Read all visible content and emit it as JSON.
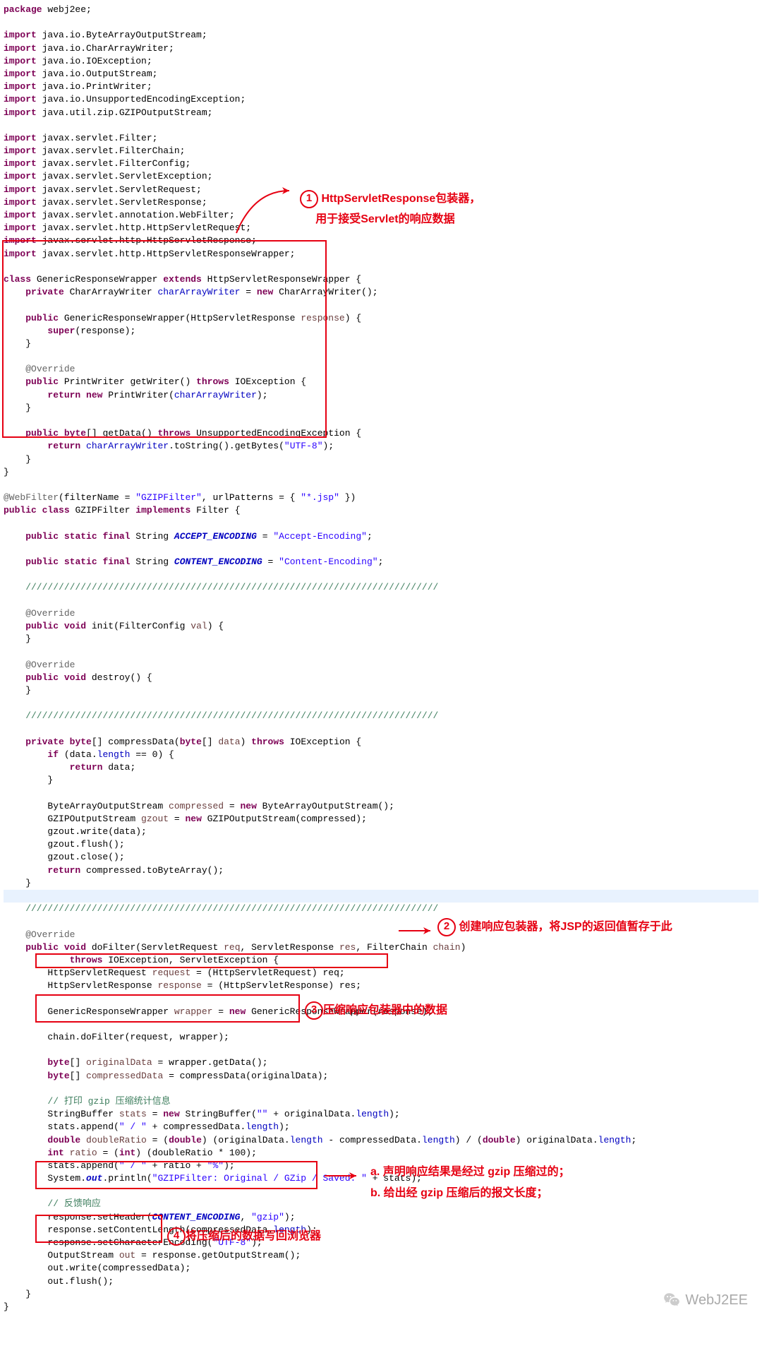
{
  "code": {
    "pkg_kw": "package",
    "pkg_name": " webj2ee;",
    "imp_kw": "import",
    "imp1": " java.io.ByteArrayOutputStream;",
    "imp2": " java.io.CharArrayWriter;",
    "imp3": " java.io.IOException;",
    "imp4": " java.io.OutputStream;",
    "imp5": " java.io.PrintWriter;",
    "imp6": " java.io.UnsupportedEncodingException;",
    "imp7": " java.util.zip.GZIPOutputStream;",
    "imp8": " javax.servlet.Filter;",
    "imp9": " javax.servlet.FilterChain;",
    "imp10": " javax.servlet.FilterConfig;",
    "imp11": " javax.servlet.ServletException;",
    "imp12": " javax.servlet.ServletRequest;",
    "imp13": " javax.servlet.ServletResponse;",
    "imp14": " javax.servlet.annotation.WebFilter;",
    "imp15": " javax.servlet.http.HttpServletRequest;",
    "imp16": " javax.servlet.http.HttpServletResponse;",
    "imp17": " javax.servlet.http.HttpServletResponseWrapper;",
    "class_kw": "class",
    "extends_kw": "extends",
    "private_kw": "private",
    "new_kw": "new",
    "public_kw": "public",
    "super_kw": "super",
    "return_kw": "return",
    "throws_kw": "throws",
    "byte_kw": "byte",
    "static_kw": "static",
    "final_kw": "final",
    "implements_kw": "implements",
    "void_kw": "void",
    "if_kw": "if",
    "int_kw": "int",
    "double_kw": "double",
    "grw_name": " GenericResponseWrapper ",
    "grw_ext": " HttpServletResponseWrapper {",
    "grw_fld1": " CharArrayWriter ",
    "grw_fldname": "charArrayWriter",
    "grw_fldinit": " CharArrayWriter();",
    "grw_ctor": " GenericResponseWrapper(HttpServletResponse ",
    "grw_ctor_p": "response",
    "grw_ctor_end": ") {",
    "grw_super": "(response);",
    "override": "@Override",
    "grw_gw1": " PrintWriter getWriter() ",
    "grw_gw2": " IOException {",
    "grw_gw_ret": " PrintWriter(",
    "grw_gw_ret2": ");",
    "grw_gd1": "[] getData() ",
    "grw_gd2": " UnsupportedEncodingException {",
    "grw_gd_ret1": ".toString().getBytes(",
    "grw_utf8": "\"UTF-8\"",
    "grw_gd_ret2": ");",
    "wf_ann": "@WebFilter",
    "wf_params": "(filterName = ",
    "wf_fn": "\"GZIPFilter\"",
    "wf_mid": ", urlPatterns = { ",
    "wf_pat": "\"*.jsp\"",
    "wf_end": " })",
    "gzf_decl": " GZIPFilter ",
    "gzf_impl": " Filter {",
    "ae_decl": " String ",
    "ae_name": "ACCEPT_ENCODING",
    "ae_eq": " = ",
    "ae_val": "\"Accept-Encoding\"",
    "semi": ";",
    "ce_name": "CONTENT_ENCODING",
    "ce_val": "\"Content-Encoding\"",
    "divider": "    ///////////////////////////////////////////////////////////////////////////",
    "init_sig": " init(FilterConfig ",
    "init_p": "val",
    "init_end": ") {",
    "destroy_sig": " destroy() {",
    "cd_sig1": "[] compressData(",
    "cd_sig2": "[] ",
    "cd_p": "data",
    "cd_sig3": ") ",
    "cd_sig4": " IOException {",
    "cd_if": " (data.",
    "cd_len": "length",
    "cd_eq0": " == 0) {",
    "cd_ret": " data;",
    "cd_baos1": "        ByteArrayOutputStream ",
    "cd_comp": "compressed",
    "cd_baos2": " ByteArrayOutputStream();",
    "cd_gz1": "        GZIPOutputStream ",
    "cd_gzout": "gzout",
    "cd_gz2": " GZIPOutputStream(compressed);",
    "cd_w": "        gzout.write(data);",
    "cd_f": "        gzout.flush();",
    "cd_c": "        gzout.close();",
    "cd_r": " compressed.toByteArray();",
    "df_sig1": " doFilter(ServletRequest ",
    "df_req": "req",
    "df_sig2": ", ServletResponse ",
    "df_res": "res",
    "df_sig3": ", FilterChain ",
    "df_chain": "chain",
    "df_sig4": ")",
    "df_throws": " IOException, ServletException {",
    "df_l1a": "        HttpServletRequest ",
    "df_request": "request",
    "df_l1b": " = (HttpServletRequest) req;",
    "df_l2a": "        HttpServletResponse ",
    "df_response": "response",
    "df_l2b": " = (HttpServletResponse) res;",
    "df_l3a": "        GenericResponseWrapper ",
    "df_wrapper": "wrapper",
    "df_l3b": " GenericResponseWrapper(response);",
    "df_l4": "        chain.doFilter(request, wrapper);",
    "df_l5a": "[] ",
    "df_od": "originalData",
    "df_l5b": " = wrapper.getData();",
    "df_cd": "compressedData",
    "df_l6b": " = compressData(originalData);",
    "df_com1": "// 打印 gzip 压缩统计信息",
    "df_sb1": "        StringBuffer ",
    "df_stats": "stats",
    "df_sb2": " StringBuffer(",
    "df_emp": "\"\"",
    "df_sb3": " + originalData.",
    "df_sb4": ");",
    "df_ap1": "        stats.append(",
    "df_slash": "\" / \"",
    "df_ap2": " + compressedData.",
    "df_dr1": "doubleRatio",
    "df_dr2": " = (",
    "df_dr3": ") (originalData.",
    "df_dr4": " - compressedData.",
    "df_dr5": ") / (",
    "df_dr6": ") originalData.",
    "df_ratio": "ratio",
    "df_r2": " = (",
    "df_r3": ") (doubleRatio * 100);",
    "df_pct": "\"%\"",
    "df_ap3": " + ratio + ",
    "df_sys": "        System.",
    "df_out": "out",
    "df_pl": ".println(",
    "df_msg": "\"GZIPFilter: Original / GZip / Saved: \"",
    "df_pl2": " + stats);",
    "df_com2": "// 反馈响应",
    "df_sh1": "        response.setHeader(",
    "df_gzip": "\"gzip\"",
    "df_sh2": ");",
    "df_scl1": "        response.setContentLength(compressedData.",
    "df_sce1": "        response.setCharacterEncoding(",
    "df_os1": "        OutputStream ",
    "df_os2": " = response.getOutputStream();",
    "df_ow": "        out.write(compressedData);",
    "df_of": "        out.flush();"
  },
  "annotations": {
    "a1_l1": "HttpServletResponse包装器，",
    "a1_l2": "用于接受Servlet的响应数据",
    "a2": "创建响应包装器，将JSP的返回值暂存于此",
    "a3": "压缩响应包装器中的数据",
    "a4a": "a. 声明响应结果是经过 gzip 压缩过的；",
    "a4b": "b. 给出经 gzip 压缩后的报文长度；",
    "a5": "将压缩后的数据写回浏览器",
    "n1": "1",
    "n2": "2",
    "n3": "3",
    "n4": "4"
  },
  "watermark": "WebJ2EE"
}
